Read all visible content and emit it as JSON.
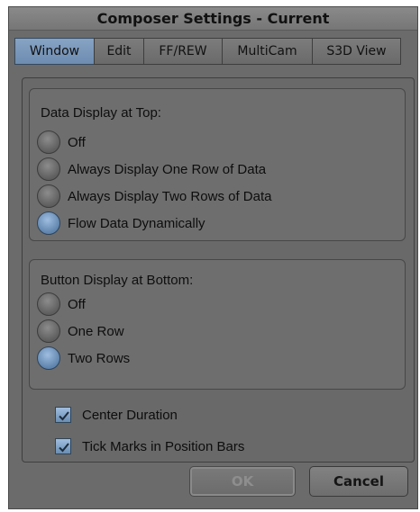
{
  "dialog": {
    "title": "Composer Settings - Current"
  },
  "tabs": [
    {
      "label": "Window",
      "active": true
    },
    {
      "label": "Edit",
      "active": false
    },
    {
      "label": "FF/REW",
      "active": false
    },
    {
      "label": "MultiCam",
      "active": false
    },
    {
      "label": "S3D View",
      "active": false
    }
  ],
  "data_display": {
    "title": "Data Display at Top:",
    "options": [
      {
        "label": "Off",
        "selected": false
      },
      {
        "label": "Always Display One Row of Data",
        "selected": false
      },
      {
        "label": "Always Display Two Rows of Data",
        "selected": false
      },
      {
        "label": "Flow Data Dynamically",
        "selected": true
      }
    ]
  },
  "button_display": {
    "title": "Button Display at Bottom:",
    "options": [
      {
        "label": "Off",
        "selected": false
      },
      {
        "label": "One Row",
        "selected": false
      },
      {
        "label": "Two Rows",
        "selected": true
      }
    ]
  },
  "checkboxes": [
    {
      "label": "Center Duration",
      "checked": true
    },
    {
      "label": "Tick Marks in Position Bars",
      "checked": true
    }
  ],
  "buttons": {
    "ok": "OK",
    "cancel": "Cancel"
  },
  "colors": {
    "accent": "#7b9cc2",
    "dialog_bg": "#6b6b6b"
  }
}
